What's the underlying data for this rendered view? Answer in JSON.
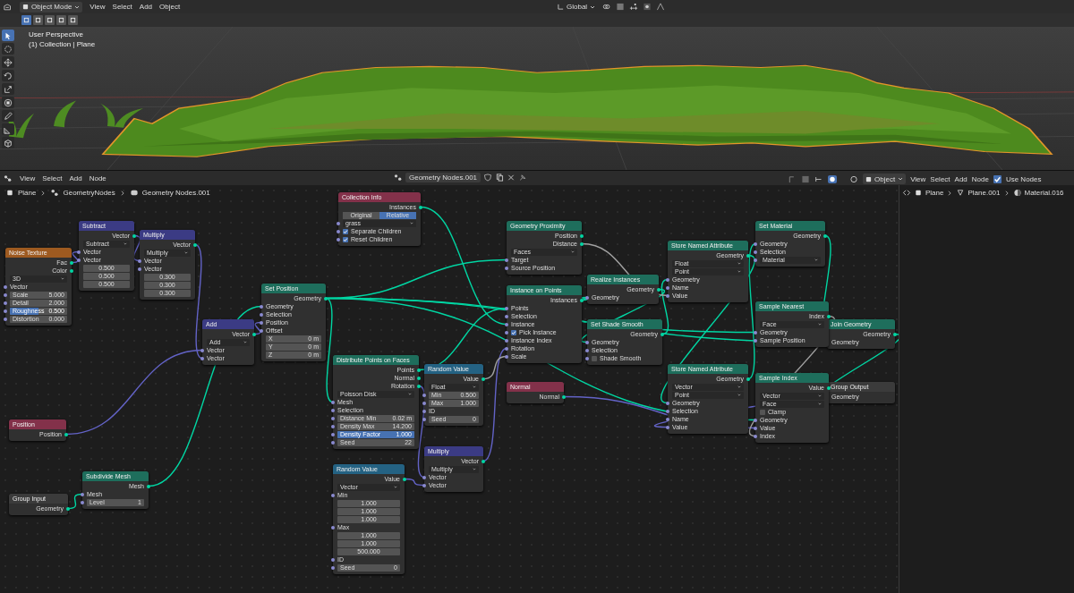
{
  "viewport": {
    "mode": "Object Mode",
    "menu": [
      "View",
      "Select",
      "Add",
      "Object"
    ],
    "orientation": "Global",
    "select_modes": [
      {
        "selected": true
      },
      {
        "selected": false
      },
      {
        "selected": false
      },
      {
        "selected": false
      },
      {
        "selected": false
      }
    ],
    "tools": [
      {
        "kind": "select",
        "selected": true
      },
      {
        "kind": "cursor",
        "selected": false
      },
      {
        "kind": "move",
        "selected": false
      },
      {
        "kind": "rotate",
        "selected": false
      },
      {
        "kind": "scale",
        "selected": false
      },
      {
        "kind": "transform",
        "selected": false
      },
      {
        "kind": "annotate",
        "selected": false
      },
      {
        "kind": "measure",
        "selected": false
      },
      {
        "kind": "add_cube",
        "selected": false
      }
    ],
    "overlay_title": "User Perspective",
    "overlay_subtitle": "(1) Collection | Plane"
  },
  "node_editor": {
    "menu": [
      "View",
      "Select",
      "Add",
      "Node"
    ],
    "tree_name": "Geometry Nodes.001",
    "breadcrumbs": [
      "Plane",
      "GeometryNodes",
      "Geometry Nodes.001"
    ],
    "nodes": [
      {
        "title": "Noise Texture",
        "color": "#9e5a20",
        "rows": [
          {
            "kind": "out",
            "label": "Fac"
          },
          {
            "kind": "out",
            "label": "Color"
          },
          {
            "kind": "menu",
            "value": "3D"
          },
          {
            "kind": "in",
            "label": "Vector"
          },
          {
            "kind": "field",
            "label": "Scale",
            "value": "5.000",
            "socket": true
          },
          {
            "kind": "field",
            "label": "Detail",
            "value": "2.000",
            "socket": true
          },
          {
            "kind": "slider",
            "label": "Roughness",
            "value": "0.500",
            "level": 0.5,
            "socket": true
          },
          {
            "kind": "field",
            "label": "Distortion",
            "value": "0.000",
            "socket": true
          }
        ]
      },
      {
        "title": "Subtract",
        "color": "#3b3b84",
        "rows": [
          {
            "kind": "out",
            "label": "Vector"
          },
          {
            "kind": "menu",
            "value": "Subtract"
          },
          {
            "kind": "in",
            "label": "Vector"
          },
          {
            "kind": "in",
            "label": "Vector"
          },
          {
            "kind": "field",
            "value": "0.500"
          },
          {
            "kind": "field",
            "value": "0.500"
          },
          {
            "kind": "field",
            "value": "0.500"
          }
        ]
      },
      {
        "title": "Multiply",
        "color": "#3b3b84",
        "rows": [
          {
            "kind": "out",
            "label": "Vector"
          },
          {
            "kind": "menu",
            "value": "Multiply"
          },
          {
            "kind": "in",
            "label": "Vector"
          },
          {
            "kind": "in",
            "label": "Vector"
          },
          {
            "kind": "field",
            "value": "0.300"
          },
          {
            "kind": "field",
            "value": "0.300"
          },
          {
            "kind": "field",
            "value": "0.300"
          }
        ]
      },
      {
        "title": "Add",
        "color": "#3b3b84",
        "rows": [
          {
            "kind": "out",
            "label": "Vector"
          },
          {
            "kind": "menu",
            "value": "Add"
          },
          {
            "kind": "in",
            "label": "Vector"
          },
          {
            "kind": "in",
            "label": "Vector"
          }
        ]
      },
      {
        "title": "Set Position",
        "color": "#1e6e5c",
        "rows": [
          {
            "kind": "out",
            "label": "Geometry"
          },
          {
            "kind": "in",
            "label": "Geometry"
          },
          {
            "kind": "in",
            "label": "Selection"
          },
          {
            "kind": "in",
            "label": "Position"
          },
          {
            "kind": "in",
            "label": "Offset"
          },
          {
            "kind": "field",
            "label": "X",
            "value": "0 m"
          },
          {
            "kind": "field",
            "label": "Y",
            "value": "0 m"
          },
          {
            "kind": "field",
            "label": "Z",
            "value": "0 m"
          }
        ]
      },
      {
        "title": "Position",
        "color": "#83314a",
        "rows": [
          {
            "kind": "out",
            "label": "Position"
          }
        ]
      },
      {
        "title": "Group Input",
        "color": "#3b3b3b",
        "rows": [
          {
            "kind": "out",
            "label": "Geometry"
          }
        ]
      },
      {
        "title": "Subdivide Mesh",
        "color": "#1e6e5c",
        "rows": [
          {
            "kind": "out",
            "label": "Mesh"
          },
          {
            "kind": "in",
            "label": "Mesh"
          },
          {
            "kind": "field",
            "label": "Level",
            "value": "1",
            "socket": true
          }
        ]
      },
      {
        "title": "Collection Info",
        "color": "#83314a",
        "rows": [
          {
            "kind": "out",
            "label": "Instances"
          },
          {
            "kind": "switch",
            "options": [
              {
                "label": "Original",
                "selected": false
              },
              {
                "label": "Relative",
                "selected": true
              }
            ]
          },
          {
            "kind": "menu",
            "value": "grass",
            "socket": true
          },
          {
            "kind": "check",
            "label": "Separate Children",
            "checked": true,
            "socket": true
          },
          {
            "kind": "check",
            "label": "Reset Children",
            "checked": true,
            "socket": true
          }
        ]
      },
      {
        "title": "Geometry Proximity",
        "color": "#1e6e5c",
        "rows": [
          {
            "kind": "out",
            "label": "Position"
          },
          {
            "kind": "out",
            "label": "Distance"
          },
          {
            "kind": "menu",
            "value": "Faces"
          },
          {
            "kind": "in",
            "label": "Target"
          },
          {
            "kind": "in",
            "label": "Source Position"
          }
        ]
      },
      {
        "title": "Distribute Points on Faces",
        "color": "#1e6e5c",
        "rows": [
          {
            "kind": "out",
            "label": "Points"
          },
          {
            "kind": "out",
            "label": "Normal"
          },
          {
            "kind": "out",
            "label": "Rotation"
          },
          {
            "kind": "menu",
            "value": "Poisson Disk"
          },
          {
            "kind": "in",
            "label": "Mesh"
          },
          {
            "kind": "in",
            "label": "Selection"
          },
          {
            "kind": "field",
            "label": "Distance Min",
            "value": "0.02 m",
            "socket": true
          },
          {
            "kind": "field",
            "label": "Density Max",
            "value": "14.200",
            "socket": true
          },
          {
            "kind": "slider",
            "label": "Density Factor",
            "value": "1.000",
            "level": 1,
            "socket": true
          },
          {
            "kind": "field",
            "label": "Seed",
            "value": "22",
            "socket": true
          }
        ]
      },
      {
        "title": "Random Value",
        "color": "#246283",
        "rows": [
          {
            "kind": "out",
            "label": "Value"
          },
          {
            "kind": "menu",
            "value": "Float"
          },
          {
            "kind": "field",
            "label": "Min",
            "value": "0.500",
            "socket": true
          },
          {
            "kind": "field",
            "label": "Max",
            "value": "1.000",
            "socket": true
          },
          {
            "kind": "in",
            "label": "ID"
          },
          {
            "kind": "field",
            "label": "Seed",
            "value": "0",
            "socket": true
          }
        ]
      },
      {
        "title": "Multiply",
        "color": "#3b3b84",
        "rows": [
          {
            "kind": "out",
            "label": "Vector"
          },
          {
            "kind": "menu",
            "value": "Multiply"
          },
          {
            "kind": "in",
            "label": "Vector"
          },
          {
            "kind": "in",
            "label": "Vector"
          }
        ]
      },
      {
        "title": "Random Value",
        "color": "#246283",
        "rows": [
          {
            "kind": "out",
            "label": "Value"
          },
          {
            "kind": "menu",
            "value": "Vector"
          },
          {
            "kind": "in",
            "label": "Min"
          },
          {
            "kind": "field",
            "value": "1.000"
          },
          {
            "kind": "field",
            "value": "1.000"
          },
          {
            "kind": "field",
            "value": "1.000"
          },
          {
            "kind": "in",
            "label": "Max"
          },
          {
            "kind": "field",
            "value": "1.000"
          },
          {
            "kind": "field",
            "value": "1.000"
          },
          {
            "kind": "field",
            "value": "500.000"
          },
          {
            "kind": "in",
            "label": "ID"
          },
          {
            "kind": "field",
            "label": "Seed",
            "value": "0",
            "socket": true
          }
        ]
      },
      {
        "title": "Instance on Points",
        "color": "#1e6e5c",
        "rows": [
          {
            "kind": "out",
            "label": "Instances"
          },
          {
            "kind": "in",
            "label": "Points"
          },
          {
            "kind": "in",
            "label": "Selection"
          },
          {
            "kind": "in",
            "label": "Instance"
          },
          {
            "kind": "check",
            "label": "Pick Instance",
            "checked": true,
            "socket": true
          },
          {
            "kind": "in",
            "label": "Instance Index"
          },
          {
            "kind": "in",
            "label": "Rotation"
          },
          {
            "kind": "in",
            "label": "Scale"
          }
        ]
      },
      {
        "title": "Normal",
        "color": "#83314a",
        "rows": [
          {
            "kind": "out",
            "label": "Normal"
          }
        ]
      },
      {
        "title": "Realize Instances",
        "color": "#1e6e5c",
        "rows": [
          {
            "kind": "out",
            "label": "Geometry"
          },
          {
            "kind": "in",
            "label": "Geometry"
          }
        ]
      },
      {
        "title": "Set Shade Smooth",
        "color": "#1e6e5c",
        "rows": [
          {
            "kind": "out",
            "label": "Geometry"
          },
          {
            "kind": "in",
            "label": "Geometry"
          },
          {
            "kind": "in",
            "label": "Selection"
          },
          {
            "kind": "check",
            "label": "Shade Smooth",
            "checked": false,
            "socket": true
          }
        ]
      },
      {
        "title": "Store Named Attribute",
        "color": "#1e6e5c",
        "rows": [
          {
            "kind": "out",
            "label": "Geometry"
          },
          {
            "kind": "menu",
            "value": "Float"
          },
          {
            "kind": "menu",
            "value": "Point"
          },
          {
            "kind": "in",
            "label": "Geometry"
          },
          {
            "kind": "in",
            "label": "Name"
          },
          {
            "kind": "in",
            "label": "Value"
          }
        ]
      },
      {
        "title": "Store Named Attribute",
        "color": "#1e6e5c",
        "rows": [
          {
            "kind": "out",
            "label": "Geometry"
          },
          {
            "kind": "menu",
            "value": "Vector"
          },
          {
            "kind": "menu",
            "value": "Point"
          },
          {
            "kind": "in",
            "label": "Geometry"
          },
          {
            "kind": "in",
            "label": "Selection"
          },
          {
            "kind": "in",
            "label": "Name"
          },
          {
            "kind": "in",
            "label": "Value"
          }
        ]
      },
      {
        "title": "Set Material",
        "color": "#1e6e5c",
        "rows": [
          {
            "kind": "out",
            "label": "Geometry"
          },
          {
            "kind": "in",
            "label": "Geometry"
          },
          {
            "kind": "in",
            "label": "Selection"
          },
          {
            "kind": "menu",
            "value": "Material",
            "socket": true
          }
        ]
      },
      {
        "title": "Join Geometry",
        "color": "#1e6e5c",
        "rows": [
          {
            "kind": "out",
            "label": "Geometry"
          },
          {
            "kind": "in",
            "label": "Geometry"
          }
        ]
      },
      {
        "title": "Group Output",
        "color": "#3b3b3b",
        "rows": [
          {
            "kind": "in",
            "label": "Geometry"
          }
        ]
      },
      {
        "title": "Sample Nearest",
        "color": "#1e6e5c",
        "rows": [
          {
            "kind": "out",
            "label": "Index"
          },
          {
            "kind": "menu",
            "value": "Face"
          },
          {
            "kind": "in",
            "label": "Geometry"
          },
          {
            "kind": "in",
            "label": "Sample Position"
          }
        ]
      },
      {
        "title": "Sample Index",
        "color": "#1e6e5c",
        "rows": [
          {
            "kind": "out",
            "label": "Value"
          },
          {
            "kind": "menu",
            "value": "Vector"
          },
          {
            "kind": "menu",
            "value": "Face"
          },
          {
            "kind": "check",
            "label": "Clamp",
            "checked": false
          },
          {
            "kind": "in",
            "label": "Geometry"
          },
          {
            "kind": "in",
            "label": "Value"
          },
          {
            "kind": "in",
            "label": "Index"
          }
        ]
      }
    ]
  },
  "shader_editor": {
    "object_mode": "Object",
    "menu": [
      "View",
      "Select",
      "Add",
      "Node"
    ],
    "use_nodes": {
      "label": "Use Nodes",
      "checked": true
    },
    "breadcrumbs": [
      "Plane",
      "Plane.001",
      "Material.016"
    ]
  }
}
